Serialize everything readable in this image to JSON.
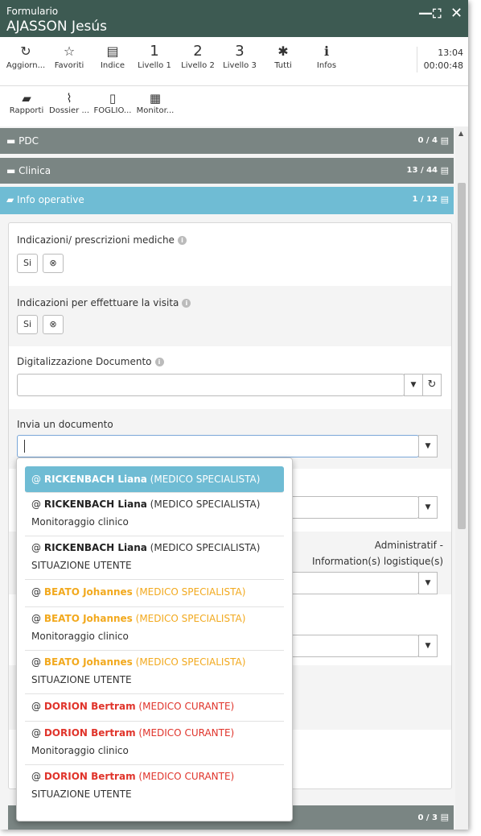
{
  "window": {
    "subtitle": "Formulario",
    "title": "AJASSON Jesús",
    "controls": {
      "minimize": "—",
      "maximize": "⛶",
      "close": "✕"
    }
  },
  "toolbar": {
    "items": [
      {
        "icon": "refresh-icon",
        "glyph": "↻",
        "label": "Aggiorn..."
      },
      {
        "icon": "star-icon",
        "glyph": "☆",
        "label": "Favoriti"
      },
      {
        "icon": "list-icon",
        "glyph": "▤",
        "label": "Indice"
      },
      {
        "icon": "level-1",
        "glyph": "1",
        "label": "Livello 1"
      },
      {
        "icon": "level-2",
        "glyph": "2",
        "label": "Livello 2"
      },
      {
        "icon": "level-3",
        "glyph": "3",
        "label": "Livello 3"
      },
      {
        "icon": "asterisk-icon",
        "glyph": "✱",
        "label": "Tutti"
      },
      {
        "icon": "info-icon",
        "glyph": "ℹ",
        "label": "Infos"
      }
    ],
    "time": "13:04",
    "elapsed": "00:00:48"
  },
  "toolbar2": {
    "items": [
      {
        "icon": "folder-open-icon",
        "glyph": "▰",
        "label": "Rapporti"
      },
      {
        "icon": "paperclip-icon",
        "glyph": "⌇",
        "label": "Dossier ..."
      },
      {
        "icon": "document-icon",
        "glyph": "▯",
        "label": "FOGLIO..."
      },
      {
        "icon": "monitor-file-icon",
        "glyph": "▦",
        "label": "Monitor..."
      }
    ]
  },
  "sections": {
    "pdc": {
      "label": "PDC",
      "count": "0 / 4"
    },
    "clinica": {
      "label": "Clinica",
      "count": "13 / 44"
    },
    "info_operative": {
      "label": "Info operative",
      "count": "1 / 12"
    },
    "bottom": {
      "count": "0 / 3"
    }
  },
  "form": {
    "f1": {
      "label": "Indicazioni/ prescrizioni mediche",
      "yes": "Si",
      "clear": "⊗"
    },
    "f2": {
      "label": "Indicazioni per effettuare la visita",
      "yes": "Si",
      "clear": "⊗"
    },
    "f3": {
      "label": "Digitalizzazione Documento",
      "value": ""
    },
    "f4": {
      "label": "Invia un documento",
      "value": ""
    },
    "right_text_1": "Administratif -",
    "right_text_2": "Information(s) logistique(s)"
  },
  "dropdown": {
    "options": [
      {
        "name": "RICKENBACH Liana",
        "role": "(MEDICO SPECIALISTA)",
        "sub": "",
        "color": "blk",
        "active": true
      },
      {
        "name": "RICKENBACH Liana",
        "role": "(MEDICO SPECIALISTA)",
        "sub": "Monitoraggio clinico",
        "color": "blk",
        "active": false
      },
      {
        "name": "RICKENBACH Liana",
        "role": "(MEDICO SPECIALISTA)",
        "sub": "SITUAZIONE UTENTE",
        "color": "blk",
        "active": false
      },
      {
        "name": "BEATO Johannes",
        "role": "(MEDICO SPECIALISTA)",
        "sub": "",
        "color": "org",
        "active": false
      },
      {
        "name": "BEATO Johannes",
        "role": "(MEDICO SPECIALISTA)",
        "sub": "Monitoraggio clinico",
        "color": "org",
        "active": false
      },
      {
        "name": "BEATO Johannes",
        "role": "(MEDICO SPECIALISTA)",
        "sub": "SITUAZIONE UTENTE",
        "color": "org",
        "active": false
      },
      {
        "name": "DORION Bertram",
        "role": "(MEDICO CURANTE)",
        "sub": "",
        "color": "red",
        "active": false
      },
      {
        "name": "DORION Bertram",
        "role": "(MEDICO CURANTE)",
        "sub": "Monitoraggio clinico",
        "color": "red",
        "active": false
      },
      {
        "name": "DORION Bertram",
        "role": "(MEDICO CURANTE)",
        "sub": "SITUAZIONE UTENTE",
        "color": "red",
        "active": false
      }
    ]
  },
  "colors": {
    "titlebar": "#3d5a52",
    "section_grey": "#7a8583",
    "section_blue": "#6fbcd4",
    "orange": "#f2a91e",
    "red": "#e0342b"
  }
}
